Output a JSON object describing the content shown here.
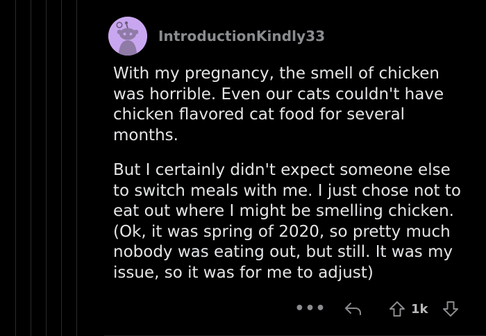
{
  "comment": {
    "author": "IntroductionKindly33",
    "paragraphs": [
      "With my pregnancy, the smell of chicken\nwas horrible. Even our cats couldn't have\nchicken flavored cat food for several\nmonths.",
      "But I certainly didn't expect someone else\nto switch meals with me. I just chose not to\neat out where I might be smelling chicken.\n(Ok, it was spring of 2020, so pretty much\nnobody was eating out, but still. It was my\nissue, so it was for me to adjust)"
    ]
  },
  "actions": {
    "more_label": "•••",
    "vote_count": "1k",
    "icons": [
      "more-icon",
      "reply-icon",
      "upvote-icon",
      "downvote-icon"
    ]
  },
  "colors": {
    "background": "#000000",
    "text": "#e3e5e7",
    "muted": "#8a8c8f",
    "avatar": "#c9a7f0",
    "thread_line": "#2b2b2b"
  }
}
